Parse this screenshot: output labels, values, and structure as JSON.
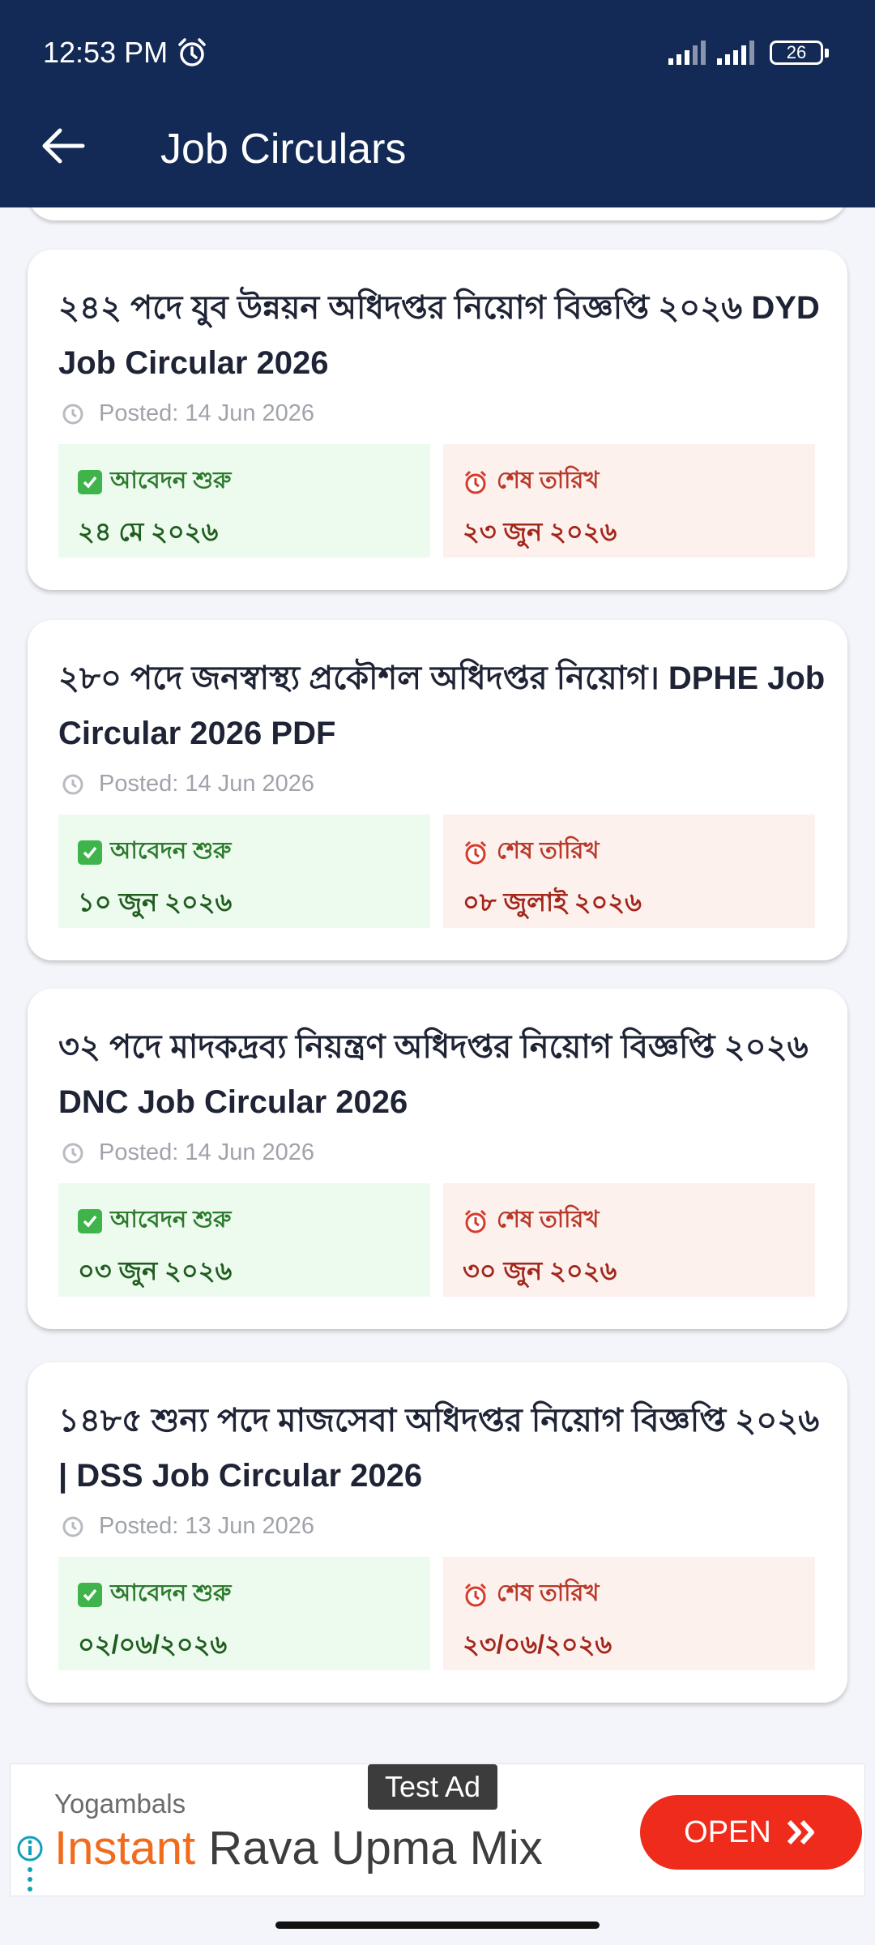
{
  "status_bar": {
    "time": "12:53 PM",
    "battery": "26"
  },
  "header": {
    "title": "Job Circulars"
  },
  "labels": {
    "start": "আবেদন শুরু",
    "end": "শেষ তারিখ"
  },
  "jobs": [
    {
      "title": "২৪২ পদে যুব উন্নয়ন অধিদপ্তর নিয়োগ বিজ্ঞপ্তি ২০২৬ DYD Job Circular 2026",
      "posted": "Posted: 14 Jun 2026",
      "start_date": "২৪ মে ২০২৬",
      "end_date": "২৩ জুন ২০২৬"
    },
    {
      "title": "২৮০ পদে জনস্বাস্থ্য প্রকৌশল অধিদপ্তর নিয়োগ। DPHE Job Circular 2026 PDF",
      "posted": "Posted: 14 Jun 2026",
      "start_date": "১০ জুন ২০২৬",
      "end_date": "০৮ জুলাই ২০২৬"
    },
    {
      "title": "৩২ পদে মাদকদ্রব্য নিয়ন্ত্রণ অধিদপ্তর নিয়োগ বিজ্ঞপ্তি ২০২৬ DNC Job Circular 2026",
      "posted": "Posted: 14 Jun 2026",
      "start_date": "০৩ জুন ২০২৬",
      "end_date": "৩০ জুন ২০২৬"
    },
    {
      "title": "১৪৮৫ শুন্য পদে মাজসেবা অধিদপ্তর নিয়োগ বিজ্ঞপ্তি ২০২৬ | DSS Job Circular 2026",
      "posted": "Posted: 13 Jun 2026",
      "start_date": "০২/০৬/২০২৬",
      "end_date": "২৩/০৬/২০২৬"
    }
  ],
  "ad": {
    "tag": "Test Ad",
    "brand": "Yogambals",
    "headline_accent": "Instant",
    "headline_rest": " Rava Upma Mix",
    "cta": "OPEN"
  },
  "colors": {
    "appbar": "#132a56",
    "start_bg": "#ecfbee",
    "end_bg": "#fdf1ee",
    "cta": "#ef2b1c"
  },
  "icons": [
    "back-arrow-icon",
    "alarm-icon",
    "signal-icon",
    "battery-icon",
    "clock-icon",
    "check-icon",
    "alarm-clock-icon",
    "info-icon",
    "double-chevron-icon"
  ]
}
